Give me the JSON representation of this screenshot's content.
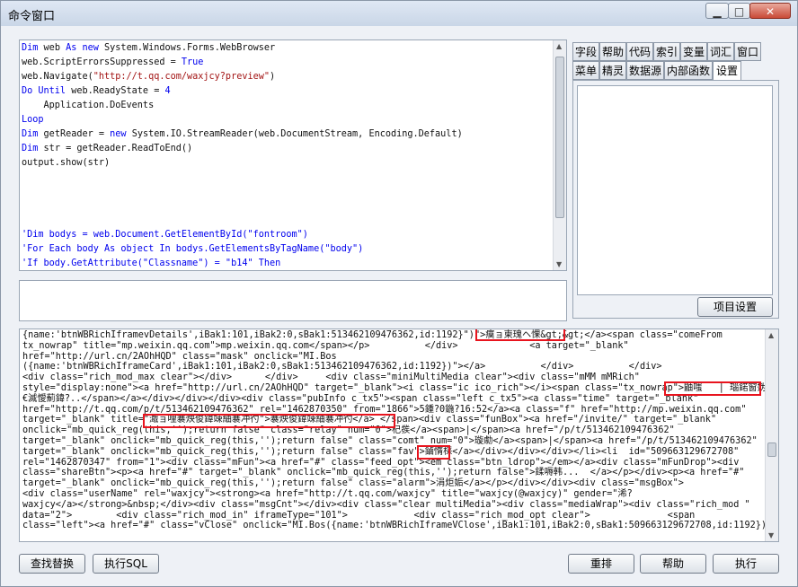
{
  "window": {
    "title": "命令窗口",
    "min_glyph": "▁",
    "max_glyph": "□",
    "close_glyph": "✕"
  },
  "editor": {
    "lines": [
      [
        {
          "t": "Dim ",
          "c": "kw"
        },
        {
          "t": "web "
        },
        {
          "t": "As new ",
          "c": "kw"
        },
        {
          "t": "System.Windows.Forms.WebBrowser"
        }
      ],
      [
        {
          "t": "web.ScriptErrorsSuppressed = "
        },
        {
          "t": "True",
          "c": "kw"
        }
      ],
      [
        {
          "t": "web.Navigate("
        },
        {
          "t": "\"http://t.qq.com/waxjcy?preview\"",
          "c": "str"
        },
        {
          "t": ")"
        }
      ],
      [
        {
          "t": "Do Until ",
          "c": "kw"
        },
        {
          "t": "web.ReadyState = "
        },
        {
          "t": "4",
          "c": "kw"
        }
      ],
      [
        {
          "t": "    Application.DoEvents"
        }
      ],
      [
        {
          "t": "Loop",
          "c": "kw"
        }
      ],
      [
        {
          "t": "Dim ",
          "c": "kw"
        },
        {
          "t": "getReader = "
        },
        {
          "t": "new ",
          "c": "kw"
        },
        {
          "t": "System.IO.StreamReader(web.DocumentStream, Encoding.Default)"
        }
      ],
      [
        {
          "t": "Dim ",
          "c": "kw"
        },
        {
          "t": "str = getReader.ReadToEnd()"
        }
      ],
      [
        {
          "t": "output.show(str)"
        }
      ],
      [
        {
          "t": ""
        }
      ],
      [
        {
          "t": ""
        }
      ],
      [
        {
          "t": ""
        }
      ],
      [
        {
          "t": ""
        }
      ],
      [
        {
          "t": "'Dim bodys = web.Document.GetElementById(\"fontroom\")",
          "c": "cmt"
        }
      ],
      [
        {
          "t": "'For Each body As object In bodys.GetElementsByTagName(\"body\")",
          "c": "cmt"
        }
      ],
      [
        {
          "t": "'If body.GetAttribute(\"Classname\") = \"b14\" Then",
          "c": "cmt"
        }
      ]
    ]
  },
  "tabs": {
    "row1": [
      "字段",
      "帮助",
      "代码",
      "索引",
      "变量",
      "词汇",
      "窗口"
    ],
    "row2": [
      "菜单",
      "精灵",
      "数据源",
      "内部函数",
      "设置"
    ],
    "active": "设置"
  },
  "panel": {
    "settings_button": "项目设置"
  },
  "output": {
    "lines": [
      "{name:'btnWBRichIframevDetails',iBak1:101,iBak2:0,sBak1:513462109476362,id:1192}\")\">瘼ョ柬瑰ヘ惈&gt;&gt;</a><span class=\"comeFrom",
      "tx_nowrap\" title=\"mp.weixin.qq.com\">mp.weixin.qq.com</span></p>          </div>             <a target=\"_blank\"",
      "href=\"http://url.cn/2AOhHQD\" class=\"mask\" onclick=\"MI.Bos",
      "({name:'btnWBRichIframeCard',iBak1:101,iBak2:0,sBak1:513462109476362,id:1192})\"></a>          </div>          </div>",
      "<div class=\"rich_mod_max clear\"></div>      </div>     <div class=\"miniMultiMedia clear\"><div class=\"mMM mMRich\"",
      "style=\"display:none\"><a href=\"http://url.cn/2AOhHQD\" target=\"_blank\"><i class=\"ic ico_rich\"></i><span class=\"tx_nowrap\">鼬嗤   | 瑙鍩窗妫",
      "€滅懓薊鍏?..</span></a></div></div></div><div class=\"pubInfo c_tx5\"><span class=\"left c_tx5\"><a class=\"time\" target=\"_blank\"",
      "href=\"http://t.qq.com/p/t/513462109476362\" rel=\"1462870350\" from=\"1866\">5鍾?0鍦?16:52</a><a class=\"f\" href=\"http://mp.weixin.qq.com\"",
      "target=\"_blank\" title=\"濈ョ哩褰炴俊鍏竦紬褰冲彴\">褰炴俊鍏竦紬褰冲彴</a> </span><div class=\"funBox\"><a href=\"/invite/\" target=\"_blank\"",
      "onclick=\"mb_quick_reg(this,'');return false\" class=\"relay\" num=\"0\">杞彂</a><span>|</span><a href=\"/p/t/513462109476362\"",
      "target=\"_blank\" onclick=\"mb_quick_reg(this,'');return false\" class=\"comt\" num=\"0\">璇勮</a><span>|</span><a href=\"/p/t/513462109476362\"",
      "target=\"_blank\" onclick=\"mb_quick_reg(this,'');return false\" class=\"fav\">鏀惰棌</a></div></div></div></li><li  id=\"509663129672708\"",
      "rel=\"1462870347\" from=\"1\"><div class=\"mFun\"><a href=\"#\" class=\"feed_opt\"><em class=\"btn_ldrop\"></em></a><div class=\"mFunDrop\"><div",
      "class=\"shareBtn\"><p><a href=\"#\" target=\"_blank\" onclick=\"mb_quick_reg(this,'');return false\">鍒嗕韩...  </a></p></div><p><a href=\"#\"",
      "target=\"_blank\" onclick=\"mb_quick_reg(this,'');return false\" class=\"alarm\">涓炬姤</a></p></div></div><div class=\"msgBox\">",
      "<div class=\"userName\" rel=\"waxjcy\"><strong><a href=\"http://t.qq.com/waxjcy\" title=\"waxjcy(@waxjcy)\" gender=\"浠?",
      "waxjcy</a></strong>&nbsp;</div><div class=\"msgCnt\"></div><div class=\"clear multiMedia\"><div class=\"mediaWrap\"><div class=\"rich_mod \"",
      "data=\"2\">        <div class=\"rich_mod_in\" iframeType=\"101\">            <div class=\"rich_mod_opt clear\">              <span",
      "class=\"left\"><a href=\"#\" class=\"vClose\" onclick=\"MI.Bos({name:'btnWBRichIframeVClose',iBak1:101,iBak2:0,sBak1:509663129672708,id:1192})\""
    ]
  },
  "buttons": {
    "find_replace": "查找替换",
    "exec_sql": "执行SQL",
    "rearrange": "重排",
    "help": "帮助",
    "execute": "执行"
  }
}
